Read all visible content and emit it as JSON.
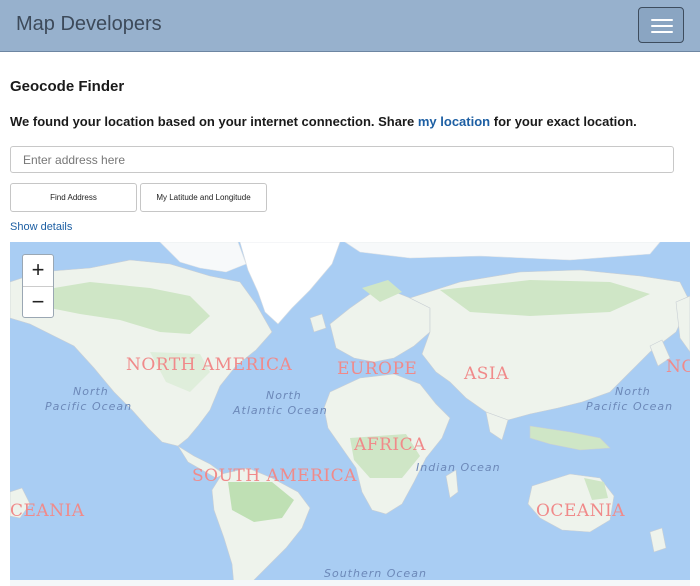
{
  "navbar": {
    "brand": "Map Developers"
  },
  "page": {
    "title": "Geocode Finder",
    "intro_before": "We found your location based on your internet connection. Share",
    "intro_link": "my location",
    "intro_after": "for your exact location."
  },
  "form": {
    "address_placeholder": "Enter address here",
    "find_address_label": "Find Address",
    "my_latlng_label": "My Latitude and Longitude",
    "show_details_label": "Show details"
  },
  "map": {
    "zoom_in": "+",
    "zoom_out": "−",
    "continent_labels": [
      "NORTH AMERICA",
      "EUROPE",
      "ASIA",
      "AFRICA",
      "SOUTH AMERICA",
      "OCEANIA",
      "CEANIA",
      "OCEANIA",
      "NC"
    ],
    "ocean_labels": {
      "north_pacific_west_1": "North",
      "north_pacific_west_2": "Pacific Ocean",
      "north_atlantic_1": "North",
      "north_atlantic_2": "Atlantic Ocean",
      "indian": "Indian Ocean",
      "north_pacific_east_1": "North",
      "north_pacific_east_2": "Pacific Ocean",
      "southern": "Southern Ocean"
    },
    "colors": {
      "water": "#a9cdf3",
      "land": "#eef3ec",
      "forest": "#cfe6c6",
      "ice": "#ffffff",
      "label": "#f08a8a"
    }
  }
}
